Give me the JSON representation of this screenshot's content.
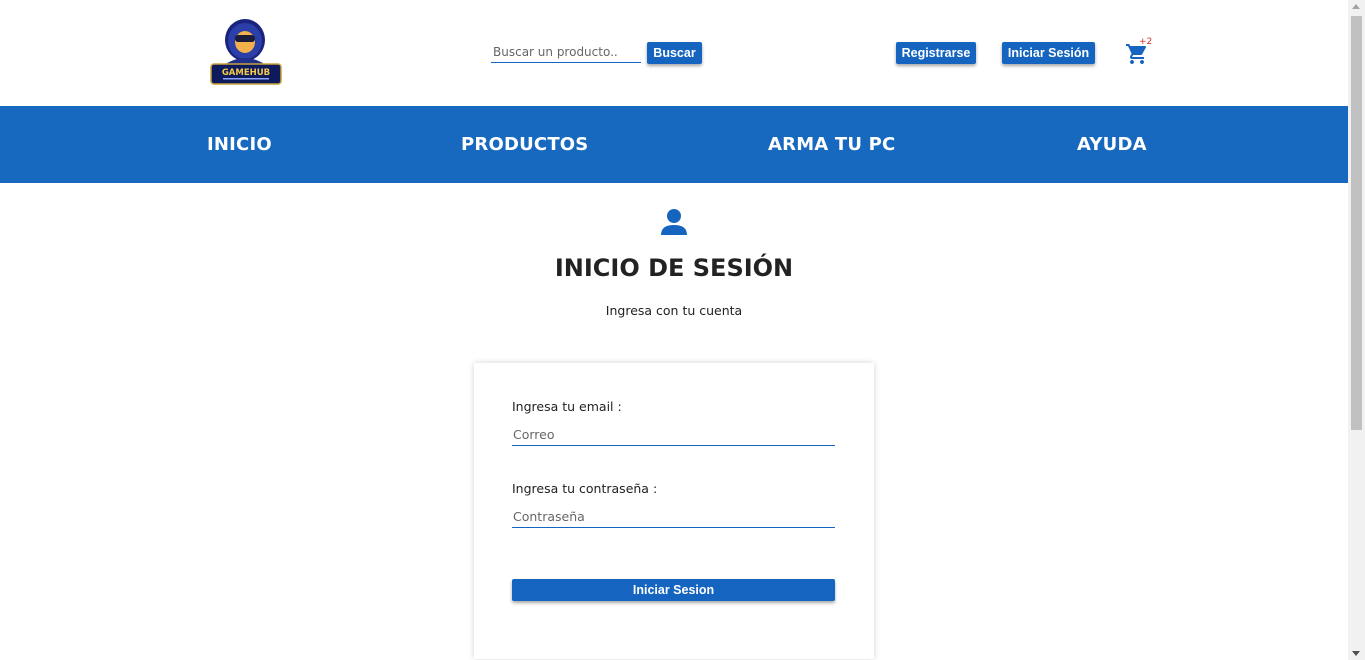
{
  "header": {
    "logo_text": "GAMEHUB",
    "search": {
      "placeholder": "Buscar un producto..",
      "value": ""
    },
    "search_button": "Buscar",
    "register_button": "Registrarse",
    "login_button": "Iniciar Sesión",
    "cart_badge": "+2"
  },
  "nav": {
    "items": [
      {
        "label": "INICIO"
      },
      {
        "label": "PRODUCTOS"
      },
      {
        "label": "ARMA TU PC"
      },
      {
        "label": "AYUDA"
      }
    ]
  },
  "main": {
    "title": "INICIO DE SESIÓN",
    "subtitle": "Ingresa con tu cuenta",
    "form": {
      "email_label": "Ingresa tu email :",
      "email_placeholder": "Correo",
      "password_label": "Ingresa tu contraseña :",
      "password_placeholder": "Contraseña",
      "submit_label": "Iniciar Sesion"
    }
  },
  "icons": {
    "user": "user-icon",
    "cart": "shopping-cart-icon"
  },
  "colors": {
    "primary": "#1565c0",
    "navbar": "#1669bf",
    "badge": "#d32f2f"
  }
}
